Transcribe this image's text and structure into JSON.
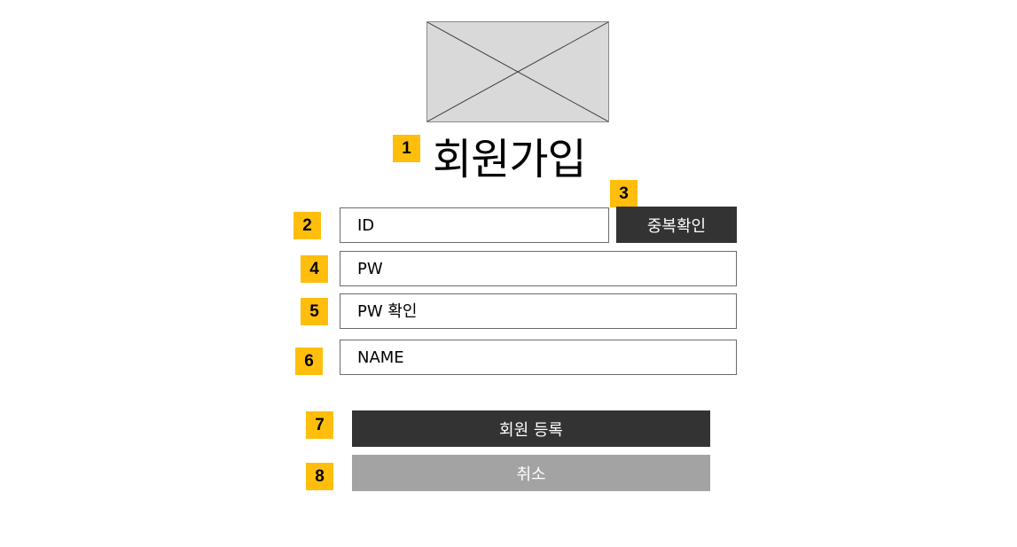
{
  "header": {
    "logo_icon": "image-placeholder-icon",
    "title": "회원가입"
  },
  "annotations": {
    "title_marker": "1",
    "id_marker": "2",
    "duplicate_check_marker": "3",
    "pw_marker": "4",
    "pw_confirm_marker": "5",
    "name_marker": "6",
    "register_marker": "7",
    "cancel_marker": "8"
  },
  "form": {
    "id_placeholder": "ID",
    "duplicate_check_label": "중복확인",
    "pw_placeholder": "PW",
    "pw_confirm_placeholder": "PW 확인",
    "name_placeholder": "NAME",
    "register_label": "회원 등록",
    "cancel_label": "취소"
  },
  "colors": {
    "marker": "#ffbe0b",
    "primary_button": "#333333",
    "secondary_button": "#a3a3a3",
    "placeholder_image": "#d9d9d9"
  }
}
